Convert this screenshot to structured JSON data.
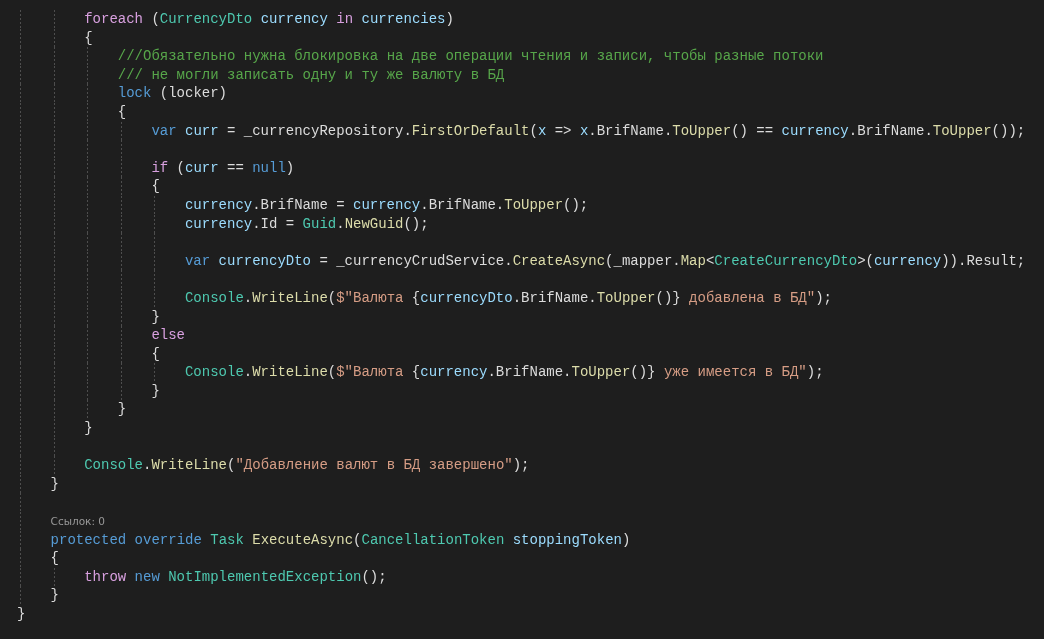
{
  "code_lines": [
    {
      "kind": "block",
      "children": [
        {
          "kind": "block",
          "children": [
            {
              "kind": "code",
              "tokens": [
                {
                  "kind": "control",
                  "text": "foreach"
                },
                {
                  "kind": "plain",
                  "text": " ("
                },
                {
                  "kind": "type",
                  "text": "CurrencyDto"
                },
                {
                  "kind": "variable",
                  "text": " currency"
                },
                {
                  "kind": "control",
                  "text": " in"
                },
                {
                  "kind": "variable",
                  "text": " currencies"
                },
                {
                  "kind": "plain",
                  "text": ")"
                }
              ]
            },
            {
              "kind": "code",
              "tokens": [
                {
                  "kind": "plain",
                  "text": "{"
                }
              ],
              "children": [
                {
                  "kind": "code",
                  "tokens": [
                    {
                      "kind": "comment",
                      "text": "///Обязательно нужна блокировка на две операции чтения и записи, чтобы разные потоки"
                    }
                  ]
                },
                {
                  "kind": "code",
                  "tokens": [
                    {
                      "kind": "comment",
                      "text": "/// не могли записать одну и ту же валюту в БД"
                    }
                  ]
                },
                {
                  "kind": "code",
                  "tokens": [
                    {
                      "kind": "keyword",
                      "text": "lock"
                    },
                    {
                      "kind": "plain",
                      "text": " (locker)"
                    }
                  ]
                },
                {
                  "kind": "code",
                  "tokens": [
                    {
                      "kind": "plain",
                      "text": "{"
                    }
                  ],
                  "children": [
                    {
                      "kind": "code",
                      "tokens": [
                        {
                          "kind": "keyword",
                          "text": "var"
                        },
                        {
                          "kind": "variable",
                          "text": " curr"
                        },
                        {
                          "kind": "plain",
                          "text": " = _currencyRepository."
                        },
                        {
                          "kind": "method",
                          "text": "FirstOrDefault"
                        },
                        {
                          "kind": "plain",
                          "text": "("
                        },
                        {
                          "kind": "variable",
                          "text": "x"
                        },
                        {
                          "kind": "plain",
                          "text": " => "
                        },
                        {
                          "kind": "variable",
                          "text": "x"
                        },
                        {
                          "kind": "plain",
                          "text": ".BrifName."
                        },
                        {
                          "kind": "method",
                          "text": "ToUpper"
                        },
                        {
                          "kind": "plain",
                          "text": "() == "
                        },
                        {
                          "kind": "variable",
                          "text": "currency"
                        },
                        {
                          "kind": "plain",
                          "text": ".BrifName."
                        },
                        {
                          "kind": "method",
                          "text": "ToUpper"
                        },
                        {
                          "kind": "plain",
                          "text": "());"
                        }
                      ]
                    },
                    {
                      "kind": "blank"
                    },
                    {
                      "kind": "code",
                      "tokens": [
                        {
                          "kind": "control",
                          "text": "if"
                        },
                        {
                          "kind": "plain",
                          "text": " ("
                        },
                        {
                          "kind": "variable",
                          "text": "curr"
                        },
                        {
                          "kind": "plain",
                          "text": " == "
                        },
                        {
                          "kind": "keyword",
                          "text": "null"
                        },
                        {
                          "kind": "plain",
                          "text": ")"
                        }
                      ]
                    },
                    {
                      "kind": "code",
                      "tokens": [
                        {
                          "kind": "plain",
                          "text": "{"
                        }
                      ],
                      "children": [
                        {
                          "kind": "code",
                          "tokens": [
                            {
                              "kind": "variable",
                              "text": "currency"
                            },
                            {
                              "kind": "plain",
                              "text": ".BrifName = "
                            },
                            {
                              "kind": "variable",
                              "text": "currency"
                            },
                            {
                              "kind": "plain",
                              "text": ".BrifName."
                            },
                            {
                              "kind": "method",
                              "text": "ToUpper"
                            },
                            {
                              "kind": "plain",
                              "text": "();"
                            }
                          ]
                        },
                        {
                          "kind": "code",
                          "tokens": [
                            {
                              "kind": "variable",
                              "text": "currency"
                            },
                            {
                              "kind": "plain",
                              "text": ".Id = "
                            },
                            {
                              "kind": "type",
                              "text": "Guid"
                            },
                            {
                              "kind": "plain",
                              "text": "."
                            },
                            {
                              "kind": "method",
                              "text": "NewGuid"
                            },
                            {
                              "kind": "plain",
                              "text": "();"
                            }
                          ]
                        },
                        {
                          "kind": "blank"
                        },
                        {
                          "kind": "code",
                          "tokens": [
                            {
                              "kind": "keyword",
                              "text": "var"
                            },
                            {
                              "kind": "variable",
                              "text": " currencyDto"
                            },
                            {
                              "kind": "plain",
                              "text": " = _currencyCrudService."
                            },
                            {
                              "kind": "method",
                              "text": "CreateAsync"
                            },
                            {
                              "kind": "plain",
                              "text": "(_mapper."
                            },
                            {
                              "kind": "method",
                              "text": "Map"
                            },
                            {
                              "kind": "plain",
                              "text": "<"
                            },
                            {
                              "kind": "type",
                              "text": "CreateCurrencyDto"
                            },
                            {
                              "kind": "plain",
                              "text": ">("
                            },
                            {
                              "kind": "variable",
                              "text": "currency"
                            },
                            {
                              "kind": "plain",
                              "text": ")).Result;"
                            }
                          ]
                        },
                        {
                          "kind": "blank"
                        },
                        {
                          "kind": "code",
                          "tokens": [
                            {
                              "kind": "type",
                              "text": "Console"
                            },
                            {
                              "kind": "plain",
                              "text": "."
                            },
                            {
                              "kind": "method",
                              "text": "WriteLine"
                            },
                            {
                              "kind": "plain",
                              "text": "("
                            },
                            {
                              "kind": "string",
                              "text": "$\"Валюта "
                            },
                            {
                              "kind": "plain",
                              "text": "{"
                            },
                            {
                              "kind": "variable",
                              "text": "currencyDto"
                            },
                            {
                              "kind": "plain",
                              "text": ".BrifName."
                            },
                            {
                              "kind": "method",
                              "text": "ToUpper"
                            },
                            {
                              "kind": "plain",
                              "text": "()}"
                            },
                            {
                              "kind": "string",
                              "text": " добавлена в БД\""
                            },
                            {
                              "kind": "plain",
                              "text": ");"
                            }
                          ]
                        }
                      ]
                    },
                    {
                      "kind": "code",
                      "tokens": [
                        {
                          "kind": "plain",
                          "text": "}"
                        }
                      ]
                    },
                    {
                      "kind": "code",
                      "tokens": [
                        {
                          "kind": "control",
                          "text": "else"
                        }
                      ]
                    },
                    {
                      "kind": "code",
                      "tokens": [
                        {
                          "kind": "plain",
                          "text": "{"
                        }
                      ],
                      "children": [
                        {
                          "kind": "code",
                          "tokens": [
                            {
                              "kind": "type",
                              "text": "Console"
                            },
                            {
                              "kind": "plain",
                              "text": "."
                            },
                            {
                              "kind": "method",
                              "text": "WriteLine"
                            },
                            {
                              "kind": "plain",
                              "text": "("
                            },
                            {
                              "kind": "string",
                              "text": "$\"Валюта "
                            },
                            {
                              "kind": "plain",
                              "text": "{"
                            },
                            {
                              "kind": "variable",
                              "text": "currency"
                            },
                            {
                              "kind": "plain",
                              "text": ".BrifName."
                            },
                            {
                              "kind": "method",
                              "text": "ToUpper"
                            },
                            {
                              "kind": "plain",
                              "text": "()}"
                            },
                            {
                              "kind": "string",
                              "text": " уже имеется в БД\""
                            },
                            {
                              "kind": "plain",
                              "text": ");"
                            }
                          ]
                        }
                      ]
                    },
                    {
                      "kind": "code",
                      "tokens": [
                        {
                          "kind": "plain",
                          "text": "}"
                        }
                      ]
                    }
                  ]
                },
                {
                  "kind": "code",
                  "tokens": [
                    {
                      "kind": "plain",
                      "text": "}"
                    }
                  ]
                }
              ]
            },
            {
              "kind": "code",
              "tokens": [
                {
                  "kind": "plain",
                  "text": "}"
                }
              ]
            },
            {
              "kind": "blank"
            },
            {
              "kind": "code",
              "tokens": [
                {
                  "kind": "type",
                  "text": "Console"
                },
                {
                  "kind": "plain",
                  "text": "."
                },
                {
                  "kind": "method",
                  "text": "WriteLine"
                },
                {
                  "kind": "plain",
                  "text": "("
                },
                {
                  "kind": "string",
                  "text": "\"Добавление валют в БД завершено\""
                },
                {
                  "kind": "plain",
                  "text": ");"
                }
              ]
            }
          ]
        },
        {
          "kind": "code",
          "tokens": [
            {
              "kind": "plain",
              "text": "}"
            }
          ]
        },
        {
          "kind": "blank"
        },
        {
          "kind": "codelens",
          "text": "Ссылок: 0"
        },
        {
          "kind": "code",
          "tokens": [
            {
              "kind": "keyword",
              "text": "protected"
            },
            {
              "kind": "keyword",
              "text": " override"
            },
            {
              "kind": "type",
              "text": " Task"
            },
            {
              "kind": "method",
              "text": " ExecuteAsync"
            },
            {
              "kind": "plain",
              "text": "("
            },
            {
              "kind": "type",
              "text": "CancellationToken"
            },
            {
              "kind": "variable",
              "text": " stoppingToken"
            },
            {
              "kind": "plain",
              "text": ")"
            }
          ]
        },
        {
          "kind": "code",
          "tokens": [
            {
              "kind": "plain",
              "text": "{"
            }
          ],
          "children": [
            {
              "kind": "code",
              "tokens": [
                {
                  "kind": "control",
                  "text": "throw"
                },
                {
                  "kind": "keyword",
                  "text": " new"
                },
                {
                  "kind": "type",
                  "text": " NotImplementedException"
                },
                {
                  "kind": "plain",
                  "text": "();"
                }
              ]
            }
          ]
        },
        {
          "kind": "code",
          "tokens": [
            {
              "kind": "plain",
              "text": "}"
            }
          ]
        }
      ]
    },
    {
      "kind": "code",
      "tokens": [
        {
          "kind": "plain",
          "text": "}"
        }
      ]
    }
  ]
}
